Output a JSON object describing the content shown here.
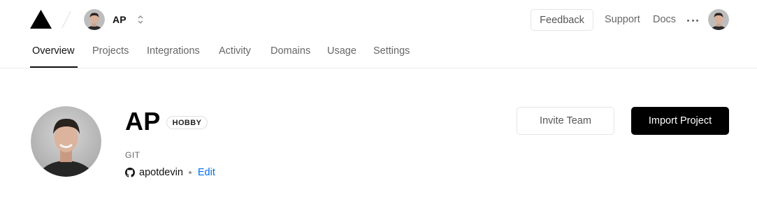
{
  "header": {
    "logo_icon": "vercel-triangle-icon",
    "team": {
      "name": "AP",
      "switch_icon": "chevron-up-down-icon"
    },
    "feedback_label": "Feedback",
    "links": [
      {
        "label": "Support"
      },
      {
        "label": "Docs"
      }
    ],
    "more_icon": "ellipsis-icon",
    "user_avatar_icon": "user-avatar"
  },
  "tabs": [
    {
      "label": "Overview",
      "active": true
    },
    {
      "label": "Projects",
      "active": false
    },
    {
      "label": "Integrations",
      "active": false
    },
    {
      "label": "Activity",
      "active": false
    },
    {
      "label": "Domains",
      "active": false
    },
    {
      "label": "Usage",
      "active": false
    },
    {
      "label": "Settings",
      "active": false
    }
  ],
  "profile": {
    "name": "AP",
    "plan_badge": "HOBBY",
    "git_label": "GIT",
    "git_provider_icon": "github-icon",
    "git_username": "apotdevin",
    "edit_label": "Edit"
  },
  "actions": {
    "invite_label": "Invite Team",
    "import_label": "Import Project"
  },
  "colors": {
    "accent_link": "#0070f3",
    "primary_button": "#000000",
    "border": "#eaeaea"
  }
}
